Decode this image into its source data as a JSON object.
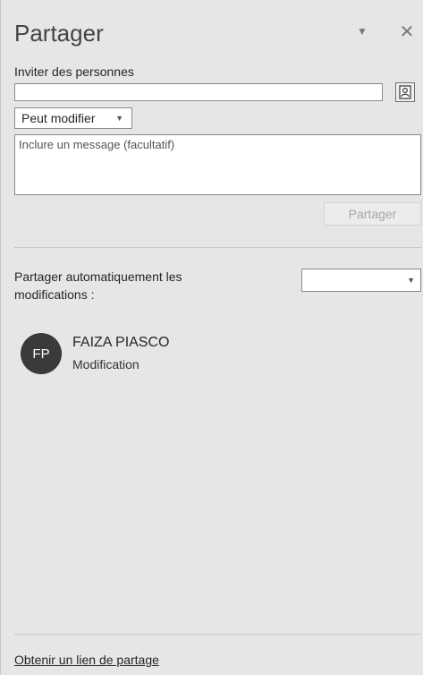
{
  "panel": {
    "title": "Partager",
    "dropdown_icon": "caret-down-icon",
    "close_icon": "close-icon"
  },
  "invite": {
    "label": "Inviter des personnes",
    "input_value": "",
    "address_book_icon": "address-book-icon"
  },
  "permission": {
    "selected": "Peut modifier"
  },
  "message": {
    "placeholder": "Inclure un message (facultatif)"
  },
  "share_button": "Partager",
  "auto_share": {
    "label": "Partager automatiquement les modifications :",
    "selected": ""
  },
  "people": [
    {
      "initials": "FP",
      "name": "FAIZA PIASCO",
      "role": "Modification"
    }
  ],
  "footer": {
    "link": "Obtenir un lien de partage"
  }
}
